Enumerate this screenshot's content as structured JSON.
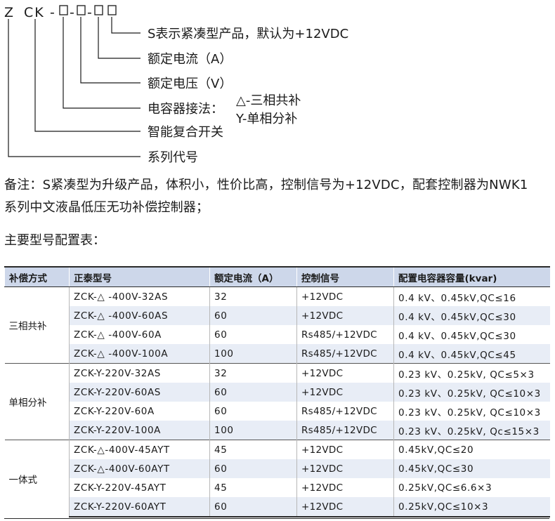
{
  "code": {
    "prefix_z": "Z",
    "prefix_ck": "CK",
    "dash": "-"
  },
  "legend": [
    {
      "text": "S表示紧凑型产品，默认为+12VDC"
    },
    {
      "text": "额定电流（A）"
    },
    {
      "text": "额定电压（V）"
    },
    {
      "text": "电容器接法：",
      "options": [
        "△-三相共补",
        "Y-单相分补"
      ]
    },
    {
      "text": "智能复合开关"
    },
    {
      "text": "系列代号"
    }
  ],
  "note": {
    "line1": "备注：S紧凑型为升级产品，体积小，性价比高，控制信号为+12VDC，配套控制器为NWK1",
    "line2": "系列中文液晶低压无功补偿控制器；"
  },
  "table_title": "主要型号配置表：",
  "table": {
    "headers": [
      "补偿方式",
      "正泰型号",
      "额定电流（A）",
      "控制信号",
      "配置电容器容量(kvar)"
    ],
    "groups": [
      {
        "name": "三相共补",
        "rows": [
          [
            "ZCK-△ -400V-32AS",
            "32",
            "+12VDC",
            "0.4 kV、0.45kV,QC≤16"
          ],
          [
            "ZCK-△ -400V-60AS",
            "60",
            "+12VDC",
            "0.4 kV、0.45kV,QC≤30"
          ],
          [
            "ZCK-△  -400V-60A",
            "60",
            "Rs485/+12VDC",
            "0.4 kV、0.45kV,QC≤30"
          ],
          [
            "ZCK-△ -400V-100A",
            "100",
            "Rs485/+12VDC",
            "0.4 kV、0.45kV,QC≤45"
          ]
        ]
      },
      {
        "name": "单相分补",
        "rows": [
          [
            "ZCK-Y-220V-32AS",
            "32",
            "+12VDC",
            "0.23 kV、0.25kV, QC≤5×3"
          ],
          [
            "ZCK-Y-220V-60AS",
            "60",
            "+12VDC",
            "0.23 kV、0.25kV, QC≤10×3"
          ],
          [
            "ZCK-Y-220V-60A",
            "60",
            "Rs485/+12VDC",
            "0.23 kV、0.25kV, QC≤10×3"
          ],
          [
            "ZCK-Y-220V-100A",
            "100",
            "Rs485/+12VDC",
            "0.23 kV、0.25kV, Qc≤15×3"
          ]
        ]
      },
      {
        "name": "一体式",
        "rows": [
          [
            "ZCK-△-400V-45AYT",
            "45",
            "+12VDC",
            "0.45kV,QC≤20"
          ],
          [
            "ZCK-△-400V-60AYT",
            "60",
            "+12VDC",
            "0.45kV,QC≤30"
          ],
          [
            "ZCK-Y-220V-45AYT",
            "45",
            "+12VDC",
            "0.25kV,QC≤6.6×3"
          ],
          [
            "ZCK-Y-220V-60AYT",
            "60",
            "+12VDC",
            "0.25kV,QC≤10×3"
          ]
        ]
      }
    ]
  }
}
